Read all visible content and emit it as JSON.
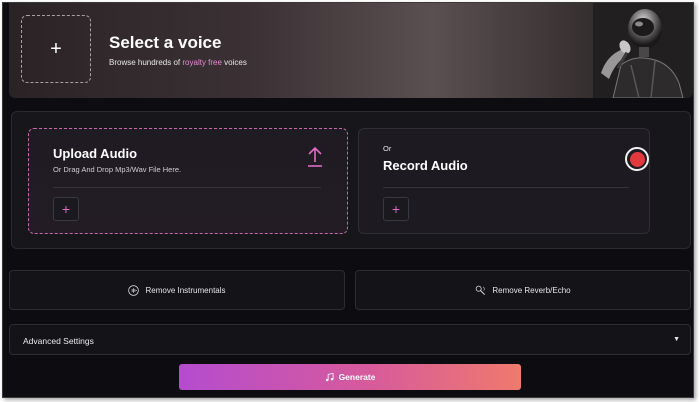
{
  "banner": {
    "add_symbol": "+",
    "title": "Select a voice",
    "subtitle_pre": "Browse hundreds of ",
    "subtitle_highlight": "royalty free",
    "subtitle_post": " voices"
  },
  "upload": {
    "title": "Upload Audio",
    "subtitle": "Or Drag And Drop Mp3/Wav File Here.",
    "add_symbol": "+",
    "icon": "upload-arrow-icon"
  },
  "record": {
    "prefix": "Or",
    "title": "Record Audio",
    "add_symbol": "+",
    "icon": "record-icon"
  },
  "actions": {
    "remove_instrumentals": "Remove Instrumentals",
    "remove_reverb": "Remove Reverb/Echo"
  },
  "advanced": {
    "label": "Advanced Settings",
    "caret": "▼"
  },
  "generate": {
    "label": "Generate",
    "icon": "music-note-icon"
  },
  "colors": {
    "accent_pink": "#e06ac6",
    "highlight_pink": "#e58ad4",
    "record_red": "#e2393f",
    "gradient_start": "#b44ccf",
    "gradient_end": "#ef7a6d",
    "background": "#0d0c10"
  }
}
